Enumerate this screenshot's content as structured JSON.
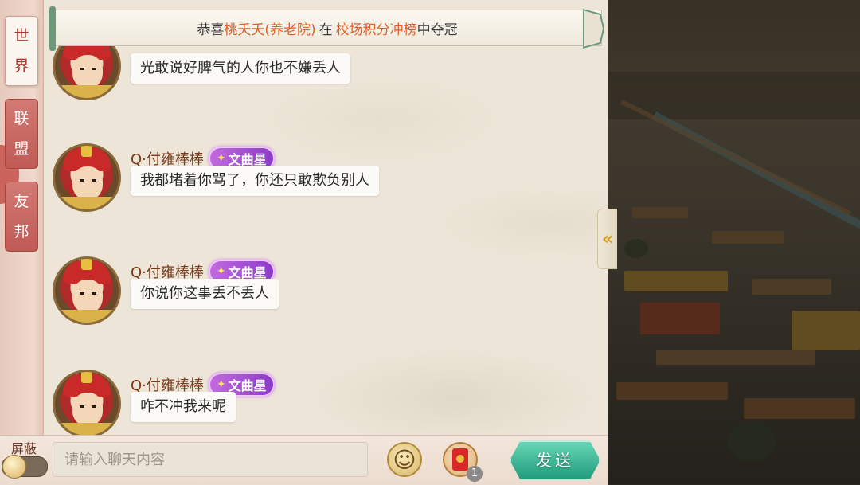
{
  "sidebar": {
    "tabs": [
      {
        "chars": [
          "世",
          "界"
        ],
        "active": true
      },
      {
        "chars": [
          "联",
          "盟"
        ],
        "active": false
      },
      {
        "chars": [
          "友",
          "邦"
        ],
        "active": false
      }
    ]
  },
  "banner": {
    "prefix": "恭喜",
    "player": "桃夭夭(养老院)",
    "middle": "在",
    "event": "校场积分冲榜",
    "suffix": "中夺冠",
    "highlight_color": "#e0602a"
  },
  "messages": [
    {
      "name": "",
      "badge": "",
      "text": "光敢说好脾气的人你也不嫌丢人"
    },
    {
      "name": "Q·付雍棒棒",
      "badge": "文曲星",
      "text": "我都堵着你骂了，你还只敢欺负别人"
    },
    {
      "name": "Q·付雍棒棒",
      "badge": "文曲星",
      "text": "你说你这事丢不丢人"
    },
    {
      "name": "Q·付雍棒棒",
      "badge": "文曲星",
      "text": "咋不冲我来呢"
    }
  ],
  "bottom": {
    "block_label": "屏蔽",
    "input_placeholder": "请输入聊天内容",
    "input_value": "",
    "red_packet_count": "1",
    "send_label": "发送"
  },
  "icons": {
    "emoji": "smiley-face-icon",
    "red_packet": "red-packet-icon",
    "collapse": "double-chevron-left-icon"
  }
}
